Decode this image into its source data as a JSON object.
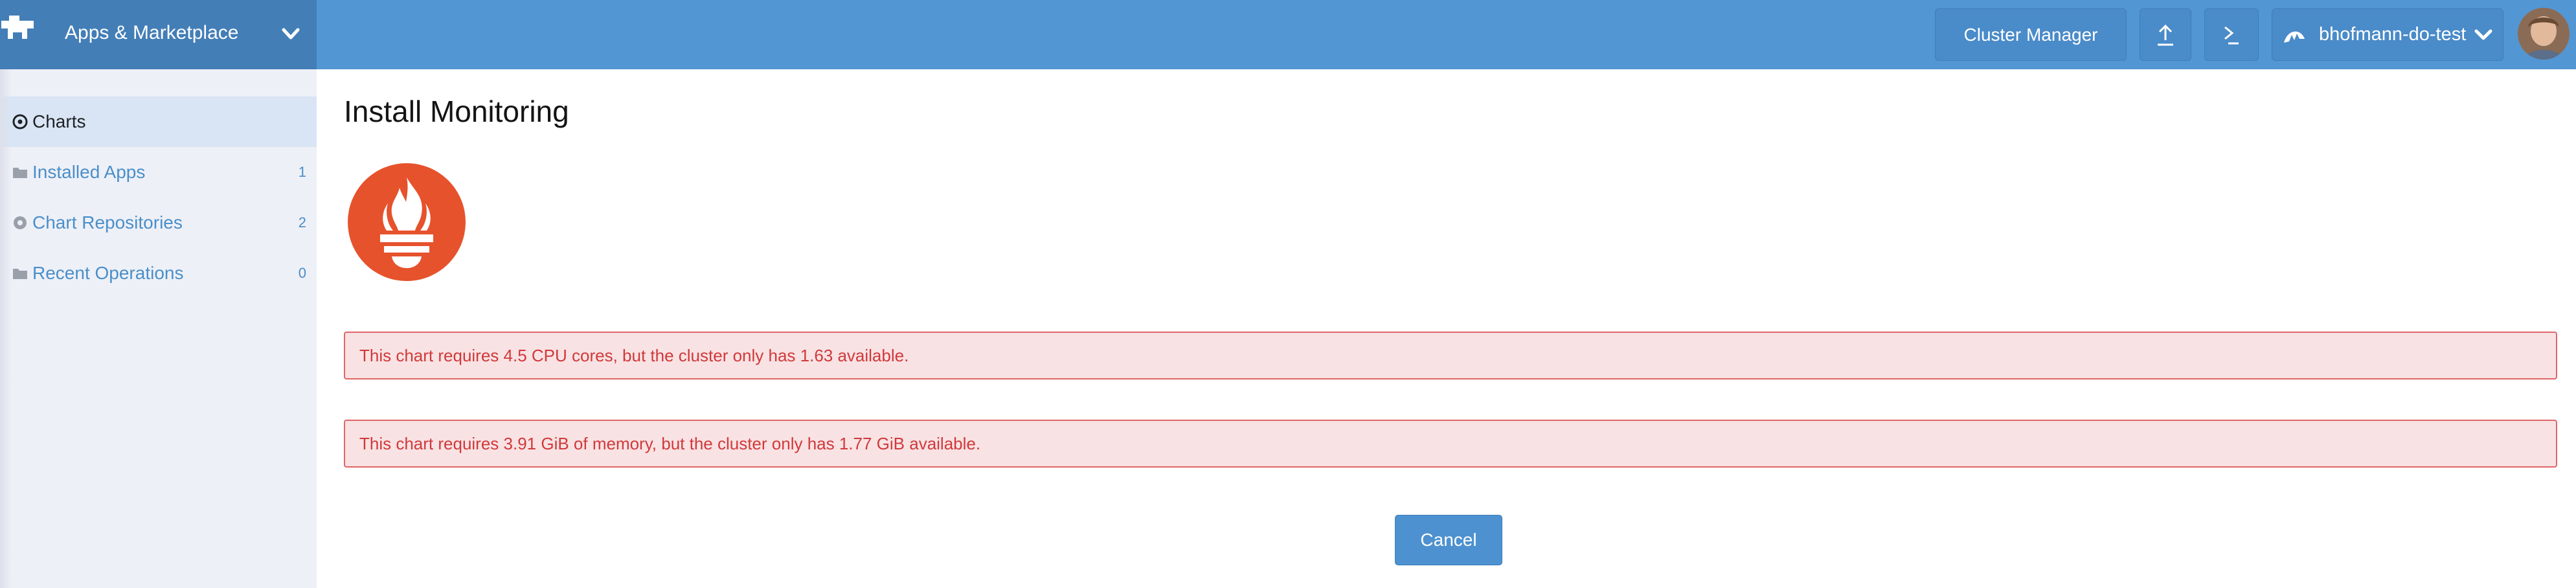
{
  "header": {
    "app_title": "Apps & Marketplace",
    "cluster_manager_label": "Cluster Manager",
    "user_label": "bhofmann-do-test",
    "icons": {
      "logo": "rancher-cow-logo",
      "app_chevron": "chevron-down-icon",
      "upload": "upload-icon",
      "shell": "terminal-icon",
      "user": "cluster-icon",
      "user_chevron": "chevron-down-icon"
    }
  },
  "sidebar": {
    "items": [
      {
        "label": "Charts",
        "count": "",
        "icon": "target-icon",
        "active": true
      },
      {
        "label": "Installed Apps",
        "count": "1",
        "icon": "folder-icon",
        "active": false
      },
      {
        "label": "Chart Repositories",
        "count": "2",
        "icon": "gear-icon",
        "active": false
      },
      {
        "label": "Recent Operations",
        "count": "0",
        "icon": "folder-icon",
        "active": false
      }
    ]
  },
  "main": {
    "title": "Install Monitoring",
    "chart_logo": "prometheus-logo",
    "alerts": [
      "This chart requires 4.5 CPU cores, but the cluster only has 1.63 available.",
      "This chart requires 3.91 GiB of memory, but the cluster only has 1.77 GiB available."
    ],
    "cancel_label": "Cancel"
  },
  "colors": {
    "header_bg": "#5296d4",
    "brand_bg": "#437eb7",
    "sidebar_bg": "#eef0f7",
    "sidebar_active_bg": "#d9e5f4",
    "link": "#4a8fc9",
    "alert_bg": "#f9e2e3",
    "alert_border": "#e06667",
    "alert_text": "#d0393b",
    "prometheus_orange": "#e6522c",
    "button_bg": "#4d91d0"
  }
}
